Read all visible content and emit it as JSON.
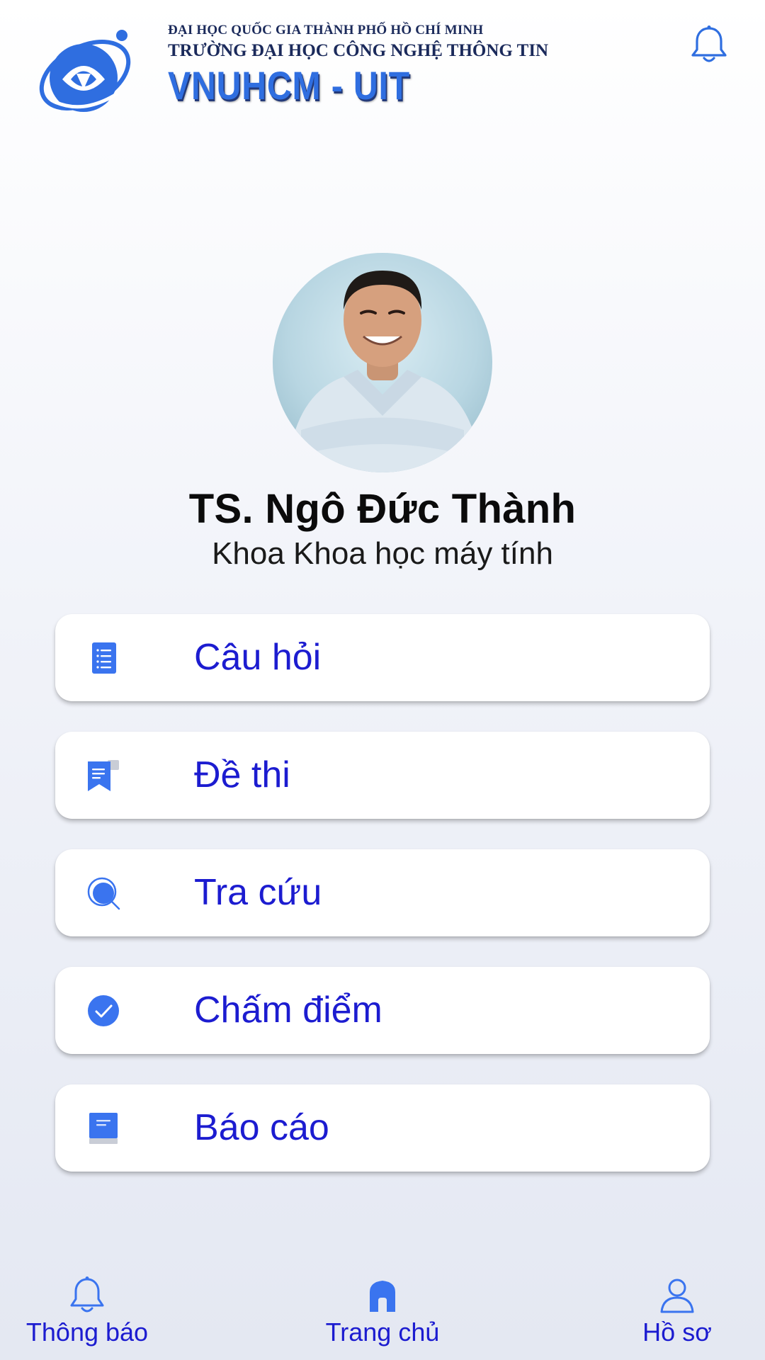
{
  "header": {
    "university_line1": "ĐẠI HỌC QUỐC GIA THÀNH PHỐ HỒ CHÍ MINH",
    "university_line2": "TRƯỜNG ĐẠI HỌC CÔNG NGHỆ THÔNG TIN",
    "university_short": "VNUHCM - UIT",
    "notification_icon": "bell-icon"
  },
  "profile": {
    "name": "TS. Ngô Đức Thành",
    "department": "Khoa Khoa học máy tính"
  },
  "menu": {
    "items": [
      {
        "label": "Câu hỏi",
        "icon": "question-list-icon"
      },
      {
        "label": "Đề thi",
        "icon": "exam-icon"
      },
      {
        "label": "Tra cứu",
        "icon": "search-icon"
      },
      {
        "label": "Chấm điểm",
        "icon": "check-circle-icon"
      },
      {
        "label": "Báo cáo",
        "icon": "report-book-icon"
      }
    ]
  },
  "bottom_nav": {
    "items": [
      {
        "label": "Thông báo",
        "icon": "bell-icon"
      },
      {
        "label": "Trang chủ",
        "icon": "home-icon",
        "active": true
      },
      {
        "label": "Hồ sơ",
        "icon": "profile-icon"
      }
    ]
  },
  "colors": {
    "accent": "#2f6ee0",
    "label_blue": "#1c1cd0",
    "icon_blue": "#3a74ef"
  }
}
